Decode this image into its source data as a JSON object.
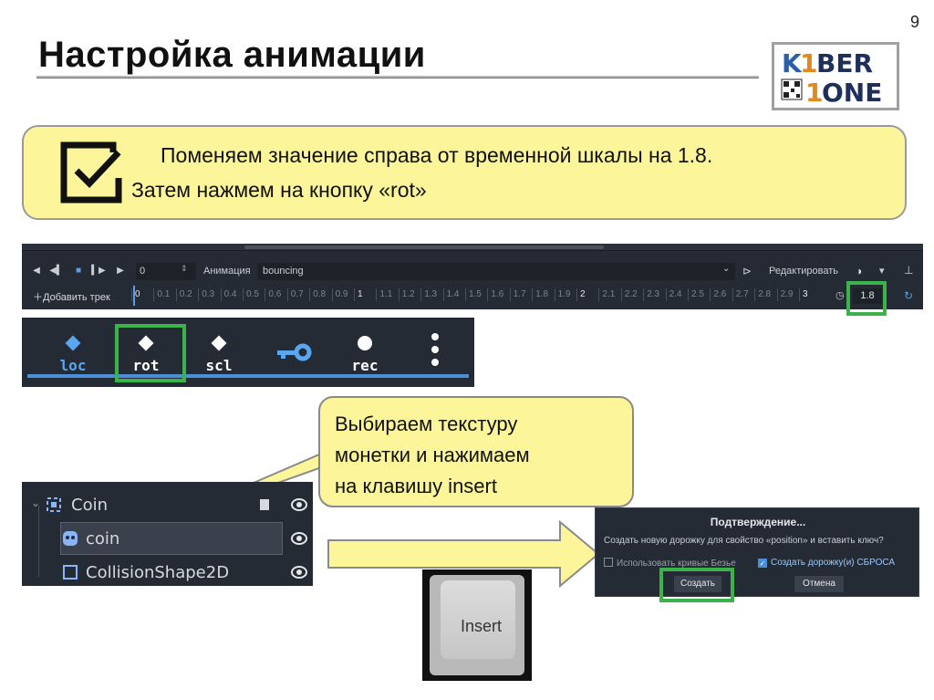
{
  "slide": {
    "page_number": "9",
    "title": "Настройка анимации",
    "logo": {
      "line1": "KIBER",
      "line2": "ONE"
    }
  },
  "info": {
    "line1": "Поменяем значение справа от временной шкалы на 1.8.",
    "line2": "Затем нажмем на кнопку «rot»"
  },
  "animation_panel": {
    "frame_value": "0",
    "animation_label": "Анимация",
    "animation_name": "bouncing",
    "edit_label": "Редактировать",
    "add_track_label": "Добавить трек",
    "timeline_ticks": [
      "0",
      "0.1",
      "0.2",
      "0.3",
      "0.4",
      "0.5",
      "0.6",
      "0.7",
      "0.8",
      "0.9",
      "1",
      "1.1",
      "1.2",
      "1.3",
      "1.4",
      "1.5",
      "1.6",
      "1.7",
      "1.8",
      "1.9",
      "2",
      "2.1",
      "2.2",
      "2.3",
      "2.4",
      "2.5",
      "2.6",
      "2.7",
      "2.8",
      "2.9",
      "3"
    ],
    "length_value": "1.8"
  },
  "key_buttons": [
    {
      "label": "loc",
      "icon": "diamond-icon"
    },
    {
      "label": "rot",
      "icon": "diamond-icon"
    },
    {
      "label": "scl",
      "icon": "diamond-icon"
    },
    {
      "label": "",
      "icon": "key-icon"
    },
    {
      "label": "rec",
      "icon": "record-icon"
    }
  ],
  "callout": {
    "line1": "Выбираем текстуру",
    "line2": "монетки и нажимаем",
    "line3": "на клавишу insert"
  },
  "scene_tree": [
    {
      "label": "Coin",
      "icon": "node2d-icon"
    },
    {
      "label": "coin",
      "icon": "sprite-icon"
    },
    {
      "label": "CollisionShape2D",
      "icon": "shape-icon"
    }
  ],
  "keyboard": {
    "key_label": "Insert"
  },
  "dialog": {
    "title": "Подтверждение...",
    "message": "Создать новую дорожку для свойство «position» и вставить ключ?",
    "checkbox_bezier": "Использовать кривые Безье",
    "checkbox_reset": "Создать дорожку(и) СБРОСА",
    "create_label": "Создать",
    "cancel_label": "Отмена"
  },
  "colors": {
    "highlight": "#3cb34a",
    "box_fill": "#fdf59a",
    "godot_bg": "#252b34",
    "accent": "#4a8fd8"
  }
}
